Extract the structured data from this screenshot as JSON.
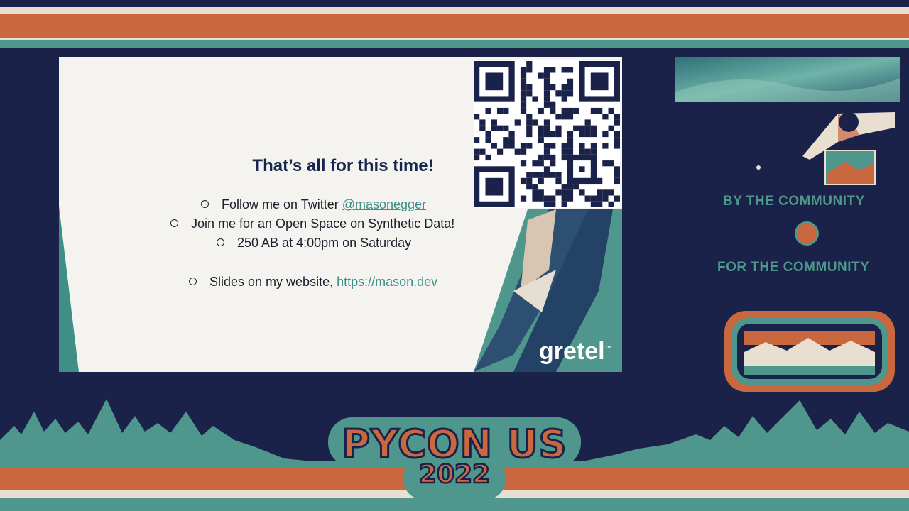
{
  "slide": {
    "title": "That’s all for this time!",
    "bullets": [
      {
        "text": "Follow me on Twitter ",
        "link": "@masonegger"
      },
      {
        "text": "Join me for an Open Space on Synthetic Data!",
        "link": ""
      },
      {
        "text": "250 AB at 4:00pm on Saturday",
        "link": ""
      },
      {
        "text": "Slides on my website, ",
        "link": "https://mason.dev"
      }
    ],
    "brand": "gretel",
    "qr_icon": "qr-code-icon"
  },
  "sidebar": {
    "tagline_top": "BY THE COMMUNITY",
    "tagline_bottom": "FOR THE COMMUNITY"
  },
  "logo": {
    "name": "PYCON US",
    "year": "2022"
  },
  "colors": {
    "navy": "#1b2249",
    "orange": "#c9673f",
    "teal": "#4f968c",
    "cream": "#e9dfd0"
  }
}
